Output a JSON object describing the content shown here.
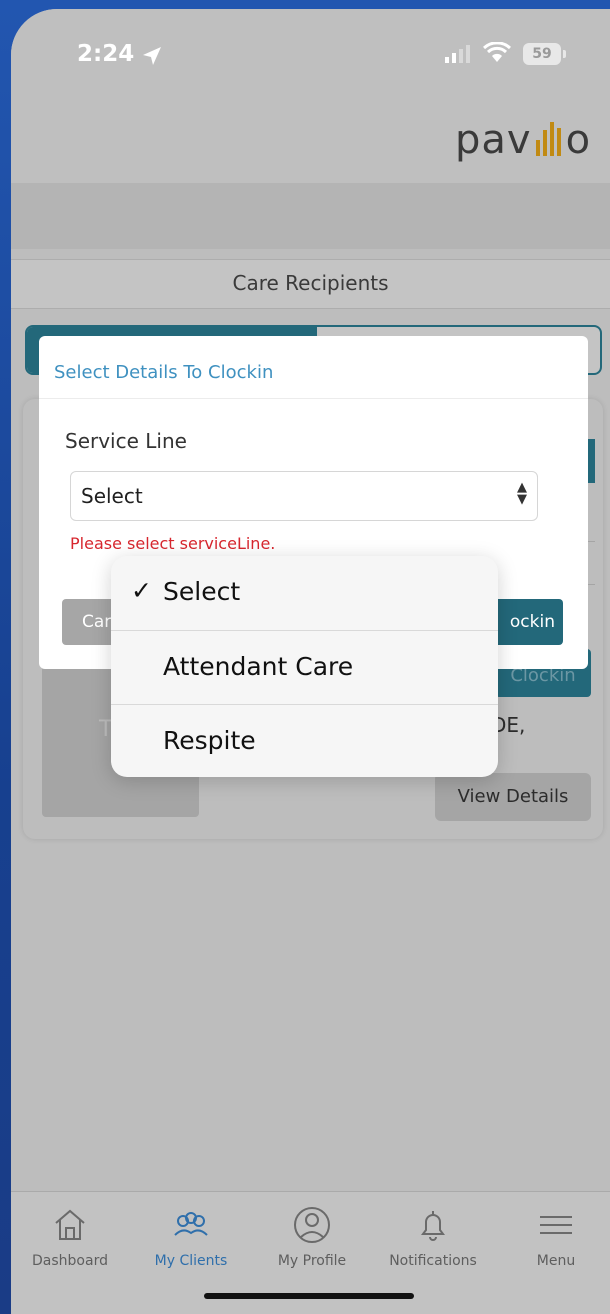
{
  "status_bar": {
    "time": "2:24",
    "battery": "59"
  },
  "header": {
    "logo_left": "pav",
    "logo_right": "o"
  },
  "page": {
    "subtitle": "Care Recipients"
  },
  "background_card": {
    "avatar_letter": "T",
    "clockin_label": "Clockin",
    "address_fragment": "DE,",
    "view_details_label": "View Details"
  },
  "modal": {
    "title": "Select Details To Clockin",
    "field_label": "Service Line",
    "select_value": "Select",
    "error": "Please select serviceLine.",
    "cancel_label": "Car",
    "clockin_label": "ockin"
  },
  "picker": {
    "options": [
      {
        "label": "Select",
        "checked": "✓"
      },
      {
        "label": "Attendant Care"
      },
      {
        "label": "Respite"
      }
    ]
  },
  "bottom_nav": {
    "items": [
      {
        "label": "Dashboard",
        "icon": "house-icon"
      },
      {
        "label": "My Clients",
        "icon": "clients-icon"
      },
      {
        "label": "My Profile",
        "icon": "profile-icon"
      },
      {
        "label": "Notifications",
        "icon": "bell-icon"
      },
      {
        "label": "Menu",
        "icon": "hamburger-icon"
      }
    ],
    "active_color": "#2f6fab"
  },
  "colors": {
    "accent": "#23687a",
    "error": "#d7262e",
    "title_blue": "#3f91c0",
    "logo_gold": "#c18a13"
  }
}
